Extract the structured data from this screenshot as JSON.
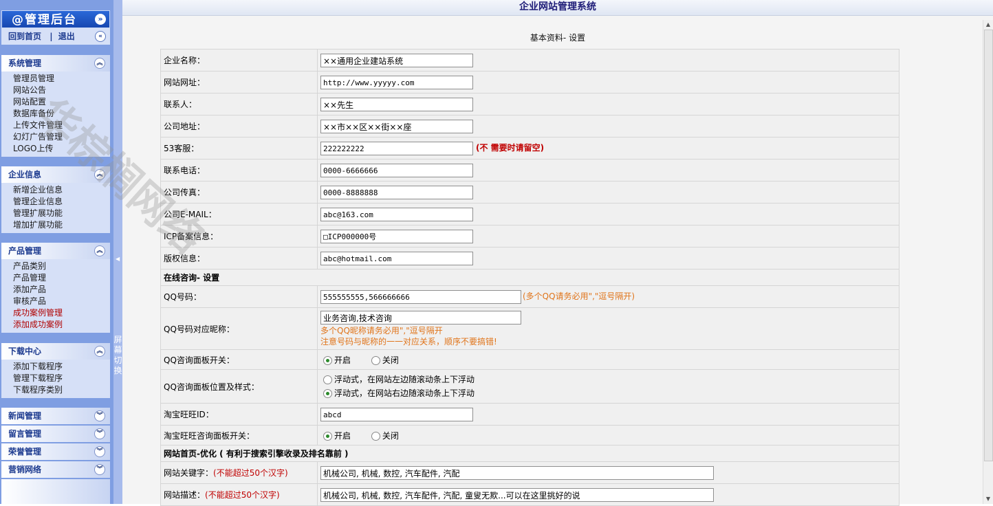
{
  "sidebar": {
    "title": "@管理后台",
    "collapse_glyph": "»",
    "links": {
      "home": "回到首页",
      "sep": "|",
      "logout": "退出",
      "toggle_glyph": "«"
    },
    "menus": [
      {
        "title": "系统管理",
        "glyph": "︽",
        "items": [
          "管理员管理",
          "网站公告",
          "网站配置",
          "数据库备份",
          "上传文件管理",
          "幻灯广告管理",
          "LOGO上传"
        ]
      },
      {
        "title": "企业信息",
        "glyph": "︽",
        "items": [
          "新增企业信息",
          "管理企业信息",
          "管理扩展功能",
          "增加扩展功能"
        ]
      },
      {
        "title": "产品管理",
        "glyph": "︽",
        "items": [
          "产品类别",
          "产品管理",
          "添加产品",
          "审核产品",
          "成功案例管理",
          "添加成功案例"
        ]
      },
      {
        "title": "下载中心",
        "glyph": "︽",
        "items": [
          "添加下载程序",
          "管理下载程序",
          "下载程序类别"
        ]
      }
    ],
    "collapsed": [
      {
        "title": "新闻管理",
        "glyph": "︾"
      },
      {
        "title": "留言管理",
        "glyph": "︾"
      },
      {
        "title": "荣誉管理",
        "glyph": "︾"
      },
      {
        "title": "营销网络",
        "glyph": "︾"
      }
    ]
  },
  "splitter": {
    "label": "屏幕切换",
    "arrow": "◀"
  },
  "header": {
    "title": "企业网站管理系统",
    "subtitle": "基本资料- 设置"
  },
  "watermark": "华棕榈网络",
  "form": {
    "company_name": {
      "label": "企业名称：",
      "value": "××通用企业建站系统"
    },
    "website": {
      "label": "网站网址：",
      "value": "http://www.yyyyy.com"
    },
    "contact": {
      "label": "联系人：",
      "value": "××先生"
    },
    "address": {
      "label": "公司地址：",
      "value": "××市××区××街××座"
    },
    "kf53": {
      "label": "53客服：",
      "value": "222222222",
      "hint": "(不 需要时请留空)"
    },
    "phone": {
      "label": "联系电话：",
      "value": "0000-6666666"
    },
    "fax": {
      "label": "公司传真：",
      "value": "0000-8888888"
    },
    "email": {
      "label": "公司E-MAIL：",
      "value": "abc@163.com"
    },
    "icp": {
      "label": "ICP备案信息：",
      "value": "□ICP000000号"
    },
    "copyright": {
      "label": "版权信息：",
      "value": "abc@hotmail.com"
    },
    "section_online": "在线咨询- 设置",
    "qq": {
      "label": "QQ号码：",
      "value": "555555555,566666666",
      "hint": "(多个QQ请务必用\",\"逗号隔开)"
    },
    "qq_nick": {
      "label": "QQ号码对应昵称：",
      "value": "业务咨询,技术咨询",
      "hint1": "多个QQ昵称请务必用\",\"逗号隔开",
      "hint2": "注意号码与昵称的一一对应关系，顺序不要搞错!"
    },
    "qq_switch": {
      "label": "QQ咨询面板开关：",
      "on": "开启",
      "off": "关闭"
    },
    "qq_pos": {
      "label": "QQ咨询面板位置及样式：",
      "left": "浮动式，在网站左边随滚动条上下浮动",
      "right": "浮动式，在网站右边随滚动条上下浮动"
    },
    "ww_id": {
      "label": "淘宝旺旺ID：",
      "value": "abcd"
    },
    "ww_switch": {
      "label": "淘宝旺旺咨询面板开关：",
      "on": "开启",
      "off": "关闭"
    },
    "section_seo": "网站首页-优化 ( 有利于搜索引擎收录及排名靠前 )",
    "keywords": {
      "label": "网站关键字：",
      "hint": "(不能超过50个汉字)",
      "value": "机械公司, 机械, 数控, 汽车配件, 汽配"
    },
    "description": {
      "label": "网站描述：",
      "hint": "(不能超过50个汉字)",
      "value": "机械公司, 机械, 数控, 汽车配件, 汽配, 童叟无欺...可以在这里挑好的说"
    }
  },
  "scroll": {
    "up": "▲",
    "down": "▼"
  }
}
